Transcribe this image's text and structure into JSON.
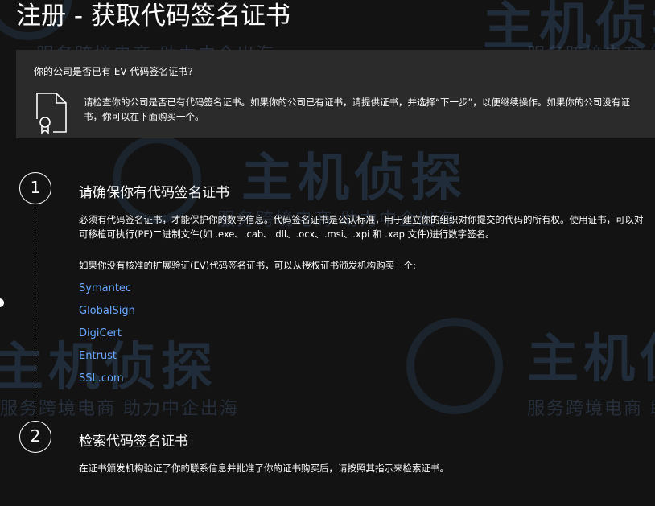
{
  "page": {
    "title": "注册 - 获取代码签名证书"
  },
  "info_panel": {
    "question": "你的公司是否已有 EV 代码签名证书?",
    "text": "请检查你的公司是否已有代码签名证书。如果你的公司已有证书，请提供证书，并选择“下一步”，以便继续操作。如果你的公司没有证书，你可以在下面购买一个。"
  },
  "steps": [
    {
      "number": "1",
      "title": "请确保你有代码签名证书",
      "paragraph1": "必须有代码签名证书，才能保护你的数字信息。代码签名证书是公认标准，用于建立你的组织对你提交的代码的所有权。使用证书，可以对可移植可执行(PE)二进制文件(如 .exe、.cab、.dll、.ocx、.msi、.xpi 和 .xap 文件)进行数字签名。",
      "paragraph2": "如果你没有核准的扩展验证(EV)代码签名证书，可以从授权证书颁发机构购买一个:",
      "vendors": [
        "Symantec",
        "GlobalSign",
        "DigiCert",
        "Entrust",
        "SSL.com"
      ]
    },
    {
      "number": "2",
      "title": "检索代码签名证书",
      "paragraph1": "在证书颁发机构验证了你的联系信息并批准了你的证书购买后，请按照其指示来检索证书。"
    }
  ],
  "watermark": {
    "logo": "主机侦探",
    "slogan": "服务跨境电商 助力中企出海"
  },
  "icons": {
    "certificate": "certificate-document-icon"
  },
  "colors": {
    "background": "#131313",
    "panel": "#2b2b2b",
    "link": "#6aa8ff"
  }
}
